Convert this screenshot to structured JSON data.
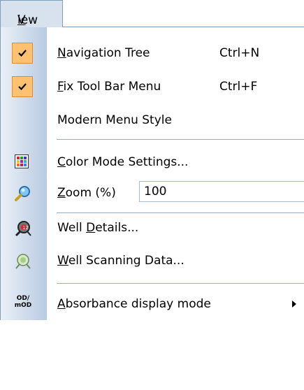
{
  "menubar": {
    "view": {
      "accel": "V",
      "rest": "iew"
    }
  },
  "menu": {
    "navigation_tree": {
      "accel": "N",
      "rest": "avigation Tree",
      "shortcut": "Ctrl+N",
      "checked": true
    },
    "fix_tool_bar": {
      "accel": "F",
      "rest": "ix Tool Bar Menu",
      "shortcut": "Ctrl+F",
      "checked": true
    },
    "modern_menu_style": {
      "label": "Modern Menu Style"
    },
    "color_mode_settings": {
      "accel": "C",
      "rest": "olor Mode Settings...",
      "icon": "color-grid-icon"
    },
    "zoom": {
      "accel": "Z",
      "rest": "oom (%)",
      "value": "100",
      "icon": "magnifier-icon"
    },
    "well_details": {
      "pre": "Well ",
      "accel": "D",
      "rest": "etails...",
      "icon": "well-details-icon"
    },
    "well_scanning": {
      "accel": "W",
      "rest": "ell Scanning Data...",
      "icon": "well-scanning-icon"
    },
    "absorbance": {
      "accel": "A",
      "rest": "bsorbance display mode",
      "icon_text_top": "OD/",
      "icon_text_bottom": "mOD"
    }
  },
  "colors": {
    "check_bg": "#ffc070",
    "check_border": "#e68b2c",
    "menu_border": "#7f9db9"
  }
}
